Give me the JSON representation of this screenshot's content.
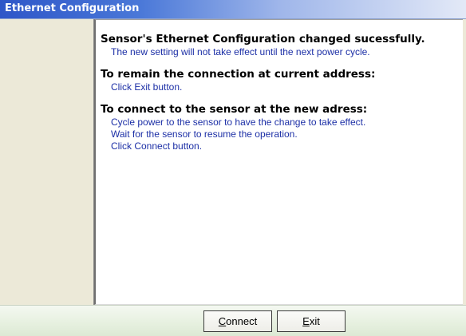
{
  "window": {
    "title": "Ethernet Configuration"
  },
  "message": {
    "status_heading": "Sensor's Ethernet Configuration changed sucessfully.",
    "status_detail": "The new setting will not take effect until the next power cycle.",
    "remain_heading": "To remain the connection at current address:",
    "remain_steps": [
      "Click Exit button."
    ],
    "connect_heading": "To connect to the sensor at the new adress:",
    "connect_steps": [
      "Cycle power to the sensor to have the change to take effect.",
      "Wait for the sensor to resume the operation.",
      "Click Connect button."
    ]
  },
  "buttons": {
    "connect_label": "Connect",
    "exit_label": "Exit"
  },
  "colors": {
    "heading": "#000000",
    "detail": "#1c2fa6",
    "title_bar": "#2e56c8"
  }
}
